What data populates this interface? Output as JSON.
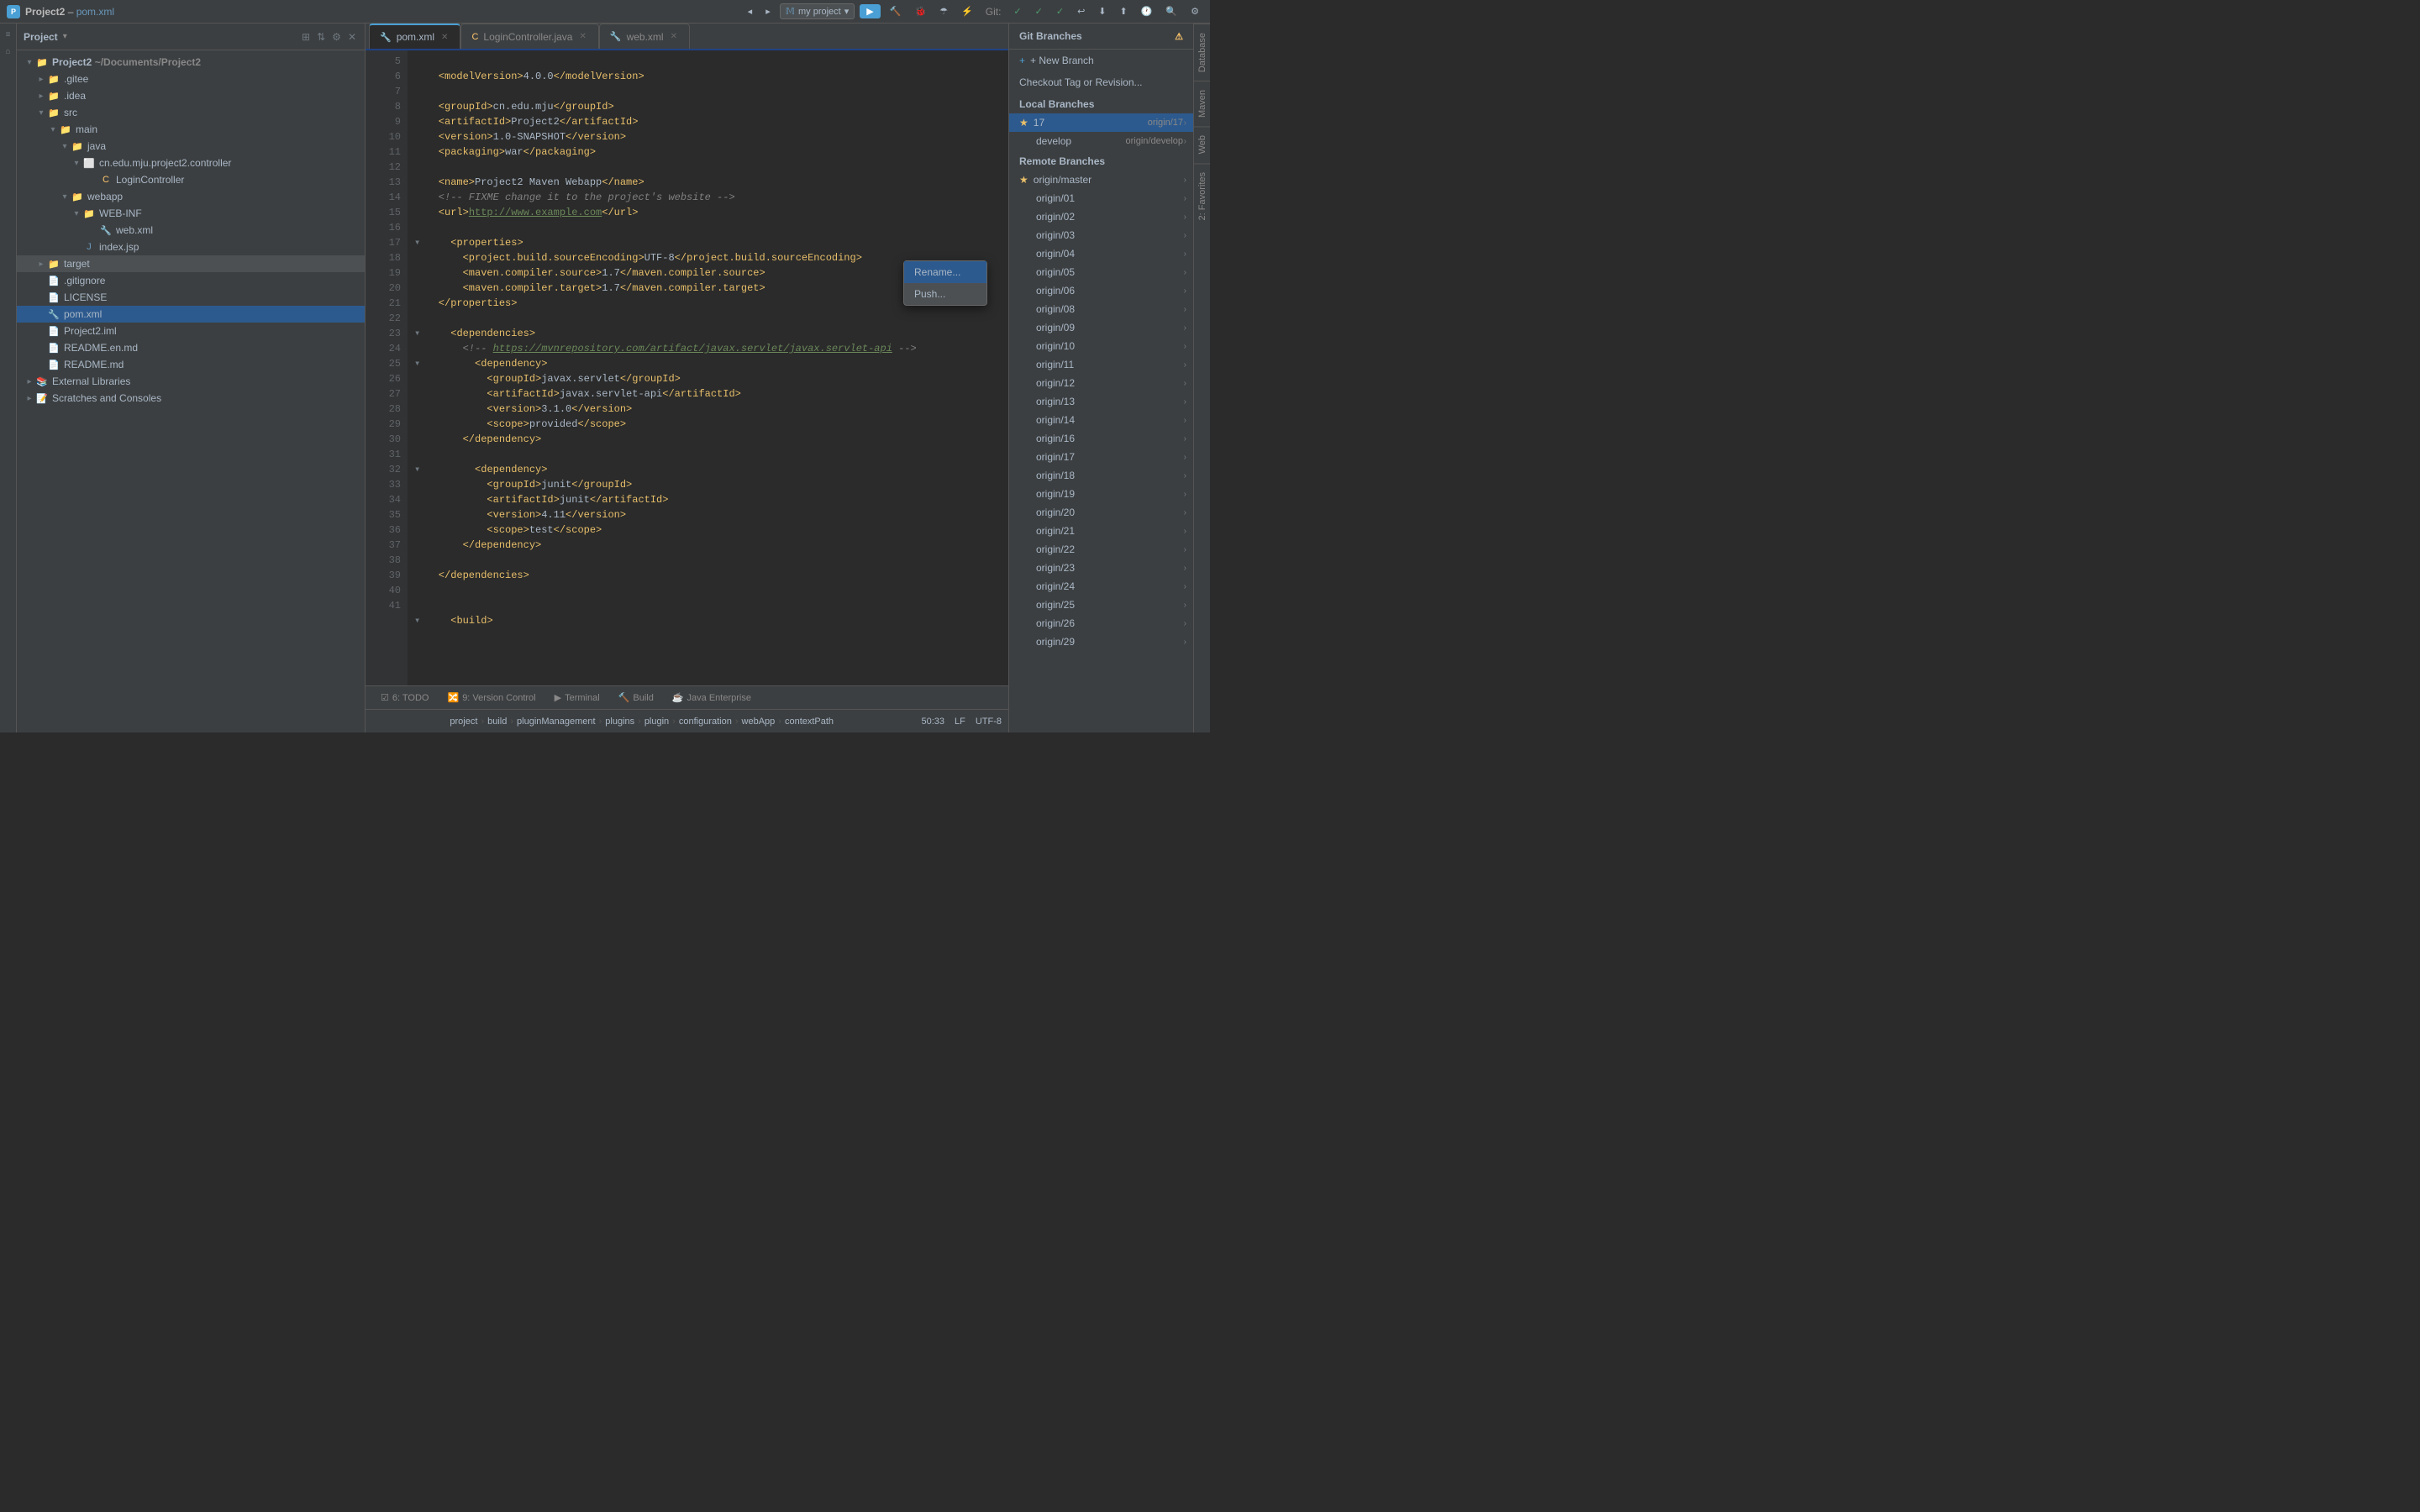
{
  "titleBar": {
    "projectName": "Project2",
    "fileName": "pom.xml",
    "projectSelector": "my project",
    "gitLabel": "Git:"
  },
  "tabs": [
    {
      "label": "pom.xml",
      "type": "xml",
      "active": true
    },
    {
      "label": "LoginController.java",
      "type": "java",
      "active": false
    },
    {
      "label": "web.xml",
      "type": "xml",
      "active": false
    }
  ],
  "fileTree": {
    "root": "Project",
    "items": [
      {
        "level": 0,
        "label": "Project2  ~/Documents/Project2",
        "type": "project",
        "expanded": true
      },
      {
        "level": 1,
        "label": ".gitee",
        "type": "folder",
        "expanded": false
      },
      {
        "level": 1,
        "label": ".idea",
        "type": "folder",
        "expanded": false
      },
      {
        "level": 1,
        "label": "src",
        "type": "folder",
        "expanded": true
      },
      {
        "level": 2,
        "label": "main",
        "type": "folder",
        "expanded": true
      },
      {
        "level": 3,
        "label": "java",
        "type": "folder",
        "expanded": true
      },
      {
        "level": 4,
        "label": "cn.edu.mju.project2.controller",
        "type": "package",
        "expanded": true
      },
      {
        "level": 5,
        "label": "LoginController",
        "type": "java"
      },
      {
        "level": 3,
        "label": "webapp",
        "type": "folder",
        "expanded": true
      },
      {
        "level": 4,
        "label": "WEB-INF",
        "type": "folder",
        "expanded": true
      },
      {
        "level": 5,
        "label": "web.xml",
        "type": "xml"
      },
      {
        "level": 4,
        "label": "index.jsp",
        "type": "jsp"
      },
      {
        "level": 1,
        "label": "target",
        "type": "folder",
        "expanded": false
      },
      {
        "level": 1,
        "label": ".gitignore",
        "type": "file"
      },
      {
        "level": 1,
        "label": "LICENSE",
        "type": "file"
      },
      {
        "level": 1,
        "label": "pom.xml",
        "type": "xml",
        "selected": true
      },
      {
        "level": 1,
        "label": "Project2.iml",
        "type": "iml"
      },
      {
        "level": 1,
        "label": "README.en.md",
        "type": "md"
      },
      {
        "level": 1,
        "label": "README.md",
        "type": "md"
      },
      {
        "level": 0,
        "label": "External Libraries",
        "type": "folder",
        "expanded": false
      },
      {
        "level": 0,
        "label": "Scratches and Consoles",
        "type": "scratches"
      }
    ]
  },
  "editor": {
    "lines": [
      {
        "num": 5,
        "content": "    <modelVersion>4.0.0</modelVersion>",
        "fold": false
      },
      {
        "num": 6,
        "content": "",
        "fold": false
      },
      {
        "num": 7,
        "content": "    <groupId>cn.edu.mju</groupId>",
        "fold": false
      },
      {
        "num": 8,
        "content": "    <artifactId>Project2</artifactId>",
        "fold": false
      },
      {
        "num": 9,
        "content": "    <version>1.0-SNAPSHOT</version>",
        "fold": false
      },
      {
        "num": 10,
        "content": "    <packaging>war</packaging>",
        "fold": false
      },
      {
        "num": 11,
        "content": "",
        "fold": false
      },
      {
        "num": 12,
        "content": "    <name>Project2 Maven Webapp</name>",
        "fold": false
      },
      {
        "num": 13,
        "content": "    <!-- FIXME change it to the project's website -->",
        "fold": false
      },
      {
        "num": 14,
        "content": "    <url>http://www.example.com</url>",
        "fold": false
      },
      {
        "num": 15,
        "content": "",
        "fold": false
      },
      {
        "num": 16,
        "content": "    <properties>",
        "fold": true
      },
      {
        "num": 17,
        "content": "        <project.build.sourceEncoding>UTF-8</project.build.sourceEncoding>",
        "fold": false
      },
      {
        "num": 18,
        "content": "        <maven.compiler.source>1.7</maven.compiler.source>",
        "fold": false
      },
      {
        "num": 19,
        "content": "        <maven.compiler.target>1.7</maven.compiler.target>",
        "fold": false
      },
      {
        "num": 20,
        "content": "    </properties>",
        "fold": false
      },
      {
        "num": 21,
        "content": "",
        "fold": false
      },
      {
        "num": 22,
        "content": "    <dependencies>",
        "fold": true
      },
      {
        "num": 23,
        "content": "        <!-- https://mvnrepository.com/artifact/javax.servlet/javax.servlet-api -->",
        "fold": false
      },
      {
        "num": 24,
        "content": "        <dependency>",
        "fold": true
      },
      {
        "num": 25,
        "content": "            <groupId>javax.servlet</groupId>",
        "fold": false
      },
      {
        "num": 26,
        "content": "            <artifactId>javax.servlet-api</artifactId>",
        "fold": false
      },
      {
        "num": 27,
        "content": "            <version>3.1.0</version>",
        "fold": false
      },
      {
        "num": 28,
        "content": "            <scope>provided</scope>",
        "fold": false
      },
      {
        "num": 29,
        "content": "        </dependency>",
        "fold": false
      },
      {
        "num": 30,
        "content": "",
        "fold": false
      },
      {
        "num": 31,
        "content": "        <dependency>",
        "fold": true
      },
      {
        "num": 32,
        "content": "            <groupId>junit</groupId>",
        "fold": false
      },
      {
        "num": 33,
        "content": "            <artifactId>junit</artifactId>",
        "fold": false
      },
      {
        "num": 34,
        "content": "            <version>4.11</version>",
        "fold": false
      },
      {
        "num": 35,
        "content": "            <scope>test</scope>",
        "fold": false
      },
      {
        "num": 36,
        "content": "        </dependency>",
        "fold": false
      },
      {
        "num": 37,
        "content": "",
        "fold": false
      },
      {
        "num": 38,
        "content": "    </dependencies>",
        "fold": false
      },
      {
        "num": 39,
        "content": "",
        "fold": false
      },
      {
        "num": 40,
        "content": "",
        "fold": false
      },
      {
        "num": 41,
        "content": "    <build>",
        "fold": true
      }
    ]
  },
  "gitBranches": {
    "title": "Git Branches",
    "newBranch": "+ New Branch",
    "checkoutTag": "Checkout Tag or Revision...",
    "localBranchesHeader": "Local Branches",
    "localBranches": [
      {
        "name": "17",
        "remote": "origin/17",
        "active": true,
        "starred": true
      },
      {
        "name": "develop",
        "remote": "origin/develop",
        "active": false,
        "starred": false
      }
    ],
    "remoteBranchesHeader": "Remote Branches",
    "remoteBranches": [
      {
        "name": "origin/master",
        "starred": true
      },
      {
        "name": "origin/01"
      },
      {
        "name": "origin/02"
      },
      {
        "name": "origin/03"
      },
      {
        "name": "origin/04"
      },
      {
        "name": "origin/05"
      },
      {
        "name": "origin/06"
      },
      {
        "name": "origin/08"
      },
      {
        "name": "origin/09"
      },
      {
        "name": "origin/10"
      },
      {
        "name": "origin/11"
      },
      {
        "name": "origin/12"
      },
      {
        "name": "origin/13"
      },
      {
        "name": "origin/14"
      },
      {
        "name": "origin/16"
      },
      {
        "name": "origin/17"
      },
      {
        "name": "origin/18"
      },
      {
        "name": "origin/19"
      },
      {
        "name": "origin/20"
      },
      {
        "name": "origin/21"
      },
      {
        "name": "origin/22"
      },
      {
        "name": "origin/23"
      },
      {
        "name": "origin/24"
      },
      {
        "name": "origin/25"
      },
      {
        "name": "origin/26"
      },
      {
        "name": "origin/29"
      }
    ]
  },
  "contextMenu": {
    "items": [
      {
        "label": "Rename..."
      },
      {
        "label": "Push..."
      }
    ]
  },
  "statusBar": {
    "todo": "6: TODO",
    "versionControl": "9: Version Control",
    "terminal": "Terminal",
    "build": "Build",
    "javaEnterprise": "Java Enterprise",
    "position": "50:33",
    "lineEnding": "LF",
    "encoding": "UTF-8"
  },
  "breadcrumb": {
    "items": [
      "project",
      "build",
      "pluginManagement",
      "plugins",
      "plugin",
      "configuration",
      "webApp",
      "contextPath"
    ]
  }
}
